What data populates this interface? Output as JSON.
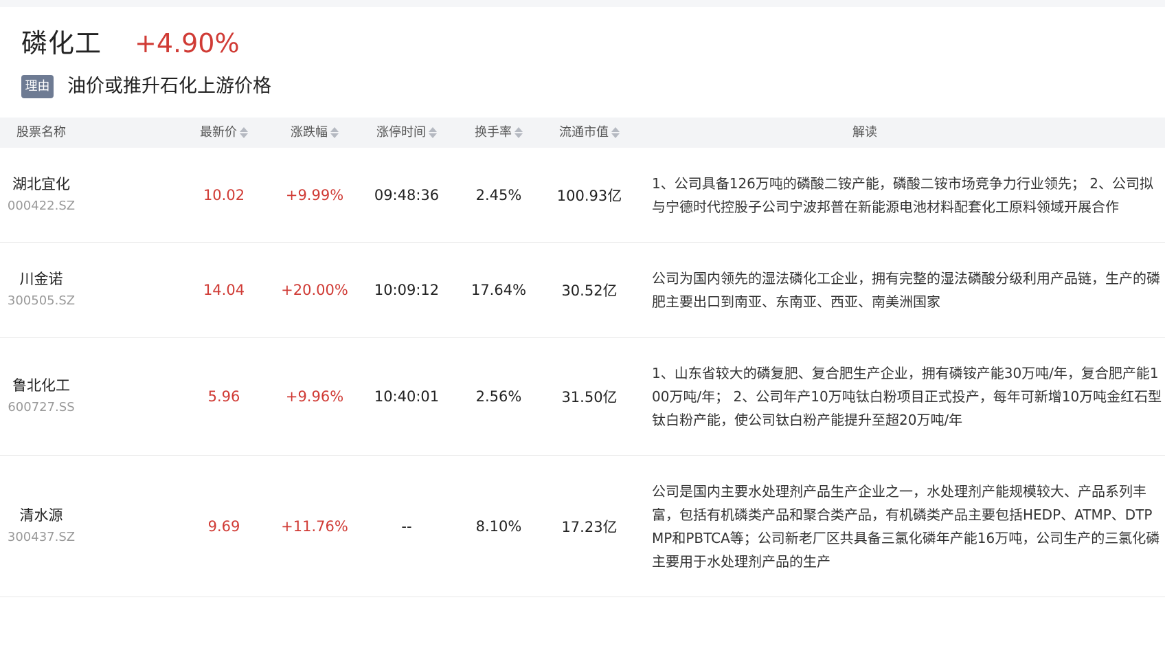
{
  "sector": {
    "name": "磷化工",
    "change": "+4.90%",
    "reason_label": "理由",
    "reason_text": "油价或推升石化上游价格"
  },
  "table": {
    "headers": {
      "name": "股票名称",
      "price": "最新价",
      "change": "涨跌幅",
      "limit_time": "涨停时间",
      "turnover": "换手率",
      "float_cap": "流通市值",
      "analysis": "解读"
    },
    "rows": [
      {
        "name": "湖北宜化",
        "code": "000422.SZ",
        "price": "10.02",
        "change": "+9.99%",
        "limit_time": "09:48:36",
        "turnover": "2.45%",
        "float_cap": "100.93亿",
        "analysis": "1、公司具备126万吨的磷酸二铵产能，磷酸二铵市场竞争力行业领先； 2、公司拟与宁德时代控股子公司宁波邦普在新能源电池材料配套化工原料领域开展合作"
      },
      {
        "name": "川金诺",
        "code": "300505.SZ",
        "price": "14.04",
        "change": "+20.00%",
        "limit_time": "10:09:12",
        "turnover": "17.64%",
        "float_cap": "30.52亿",
        "analysis": "公司为国内领先的湿法磷化工企业，拥有完整的湿法磷酸分级利用产品链，生产的磷肥主要出口到南亚、东南亚、西亚、南美洲国家"
      },
      {
        "name": "鲁北化工",
        "code": "600727.SS",
        "price": "5.96",
        "change": "+9.96%",
        "limit_time": "10:40:01",
        "turnover": "2.56%",
        "float_cap": "31.50亿",
        "analysis": "1、山东省较大的磷复肥、复合肥生产企业，拥有磷铵产能30万吨/年，复合肥产能100万吨/年； 2、公司年产10万吨钛白粉项目正式投产，每年可新增10万吨金红石型钛白粉产能，使公司钛白粉产能提升至超20万吨/年"
      },
      {
        "name": "清水源",
        "code": "300437.SZ",
        "price": "9.69",
        "change": "+11.76%",
        "limit_time": "--",
        "turnover": "8.10%",
        "float_cap": "17.23亿",
        "analysis": "公司是国内主要水处理剂产品生产企业之一，水处理剂产能规模较大、产品系列丰富，包括有机磷类产品和聚合类产品，有机磷类产品主要包括HEDP、ATMP、DTPMP和PBTCA等；公司新老厂区共具备三氯化磷年产能16万吨，公司生产的三氯化磷主要用于水处理剂产品的生产"
      }
    ]
  }
}
